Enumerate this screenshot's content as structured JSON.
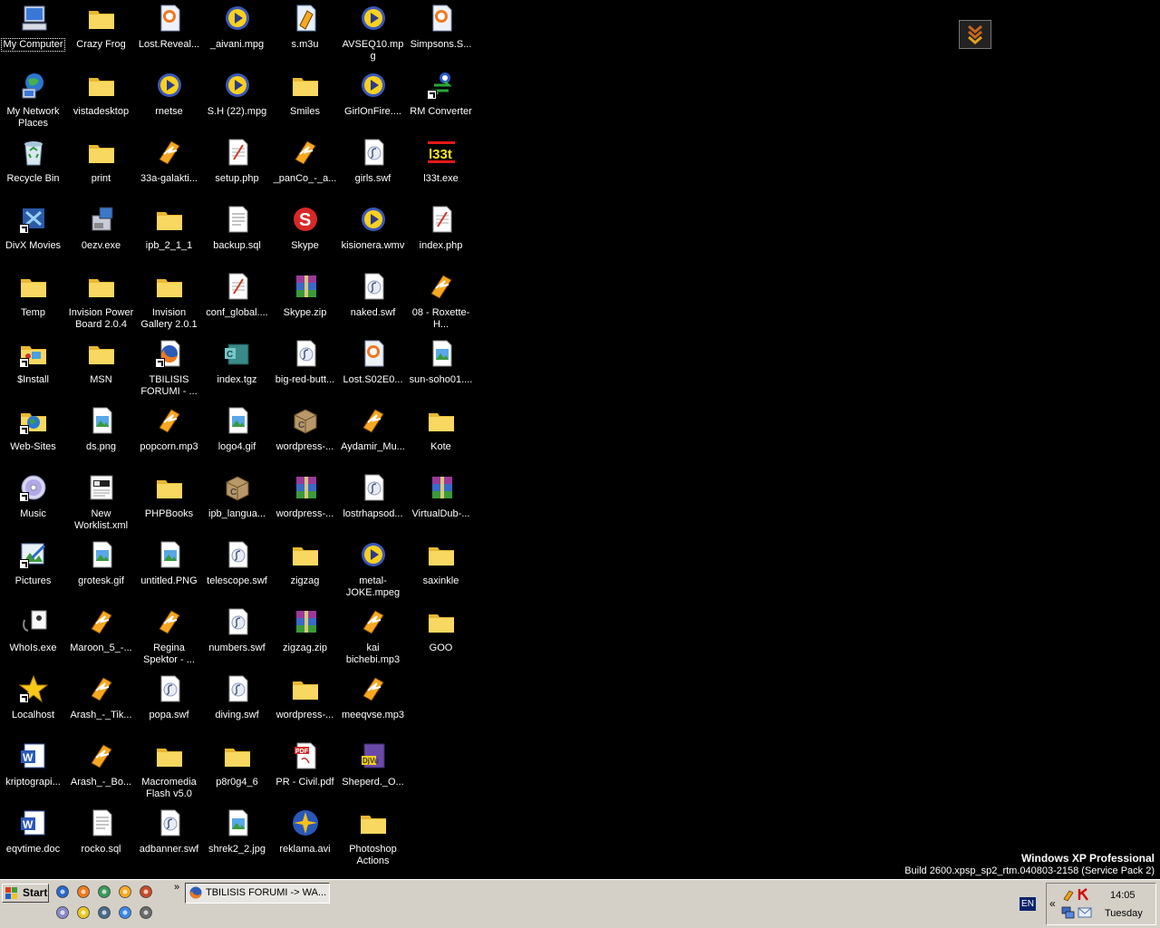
{
  "desktop": {
    "icons": [
      {
        "label": "My Computer",
        "type": "computer",
        "col": 0,
        "row": 0,
        "selected": true
      },
      {
        "label": "My Network Places",
        "type": "network",
        "col": 0,
        "row": 1
      },
      {
        "label": "Recycle Bin",
        "type": "recycle",
        "col": 0,
        "row": 2
      },
      {
        "label": "DivX Movies",
        "type": "divx",
        "col": 0,
        "row": 3,
        "shortcut": true
      },
      {
        "label": "Temp",
        "type": "folder",
        "col": 0,
        "row": 4
      },
      {
        "label": "$Install",
        "type": "folder-special",
        "col": 0,
        "row": 5,
        "shortcut": true
      },
      {
        "label": "Web-Sites",
        "type": "folder-globe",
        "col": 0,
        "row": 6,
        "shortcut": true
      },
      {
        "label": "Music",
        "type": "cd",
        "col": 0,
        "row": 7,
        "shortcut": true
      },
      {
        "label": "Pictures",
        "type": "pictures",
        "col": 0,
        "row": 8,
        "shortcut": true
      },
      {
        "label": "WhoIs.exe",
        "type": "exe",
        "col": 0,
        "row": 9
      },
      {
        "label": "Localhost",
        "type": "star",
        "col": 0,
        "row": 10,
        "shortcut": true
      },
      {
        "label": "kriptograpi...",
        "type": "word",
        "col": 0,
        "row": 11
      },
      {
        "label": "eqvtime.doc",
        "type": "word",
        "col": 0,
        "row": 12
      },
      {
        "label": "Crazy Frog",
        "type": "folder",
        "col": 1,
        "row": 0
      },
      {
        "label": "vistadesktop",
        "type": "folder",
        "col": 1,
        "row": 1
      },
      {
        "label": "print",
        "type": "folder",
        "col": 1,
        "row": 2
      },
      {
        "label": "0ezv.exe",
        "type": "setup",
        "col": 1,
        "row": 3
      },
      {
        "label": "Invision Power Board 2.0.4",
        "type": "folder",
        "col": 1,
        "row": 4
      },
      {
        "label": "MSN",
        "type": "folder",
        "col": 1,
        "row": 5
      },
      {
        "label": "ds.png",
        "type": "image",
        "col": 1,
        "row": 6
      },
      {
        "label": "New Worklist.xml",
        "type": "xml",
        "col": 1,
        "row": 7
      },
      {
        "label": "grotesk.gif",
        "type": "image",
        "col": 1,
        "row": 8
      },
      {
        "label": "Maroon_5_-...",
        "type": "winamp",
        "col": 1,
        "row": 9
      },
      {
        "label": "Arash_-_Tik...",
        "type": "winamp",
        "col": 1,
        "row": 10
      },
      {
        "label": "Arash_-_Bo...",
        "type": "winamp",
        "col": 1,
        "row": 11
      },
      {
        "label": "rocko.sql",
        "type": "text",
        "col": 1,
        "row": 12
      },
      {
        "label": "Lost.Reveal...",
        "type": "video-doc",
        "col": 2,
        "row": 0
      },
      {
        "label": "rnetse",
        "type": "media",
        "col": 2,
        "row": 1
      },
      {
        "label": "33a-galakti...",
        "type": "winamp",
        "col": 2,
        "row": 2
      },
      {
        "label": "ipb_2_1_1",
        "type": "folder",
        "col": 2,
        "row": 3
      },
      {
        "label": "Invision Gallery 2.0.1",
        "type": "folder",
        "col": 2,
        "row": 4
      },
      {
        "label": "TBILISIS FORUMI - ...",
        "type": "firefox",
        "col": 2,
        "row": 5,
        "shortcut": true
      },
      {
        "label": "popcorn.mp3",
        "type": "winamp",
        "col": 2,
        "row": 6
      },
      {
        "label": "PHPBooks",
        "type": "folder",
        "col": 2,
        "row": 7
      },
      {
        "label": "untitled.PNG",
        "type": "image",
        "col": 2,
        "row": 8
      },
      {
        "label": "Regina Spektor - ...",
        "type": "winamp",
        "col": 2,
        "row": 9
      },
      {
        "label": "popa.swf",
        "type": "swf",
        "col": 2,
        "row": 10
      },
      {
        "label": "Macromedia Flash v5.0",
        "type": "folder",
        "col": 2,
        "row": 11
      },
      {
        "label": "adbanner.swf",
        "type": "swf",
        "col": 2,
        "row": 12
      },
      {
        "label": "_aivani.mpg",
        "type": "media",
        "col": 3,
        "row": 0
      },
      {
        "label": "S.H (22).mpg",
        "type": "media",
        "col": 3,
        "row": 1
      },
      {
        "label": "setup.php",
        "type": "php",
        "col": 3,
        "row": 2
      },
      {
        "label": "backup.sql",
        "type": "text",
        "col": 3,
        "row": 3
      },
      {
        "label": "conf_global....",
        "type": "php",
        "col": 3,
        "row": 4
      },
      {
        "label": "index.tgz",
        "type": "tgz",
        "col": 3,
        "row": 5
      },
      {
        "label": "logo4.gif",
        "type": "image",
        "col": 3,
        "row": 6
      },
      {
        "label": "ipb_langua...",
        "type": "box",
        "col": 3,
        "row": 7
      },
      {
        "label": "telescope.swf",
        "type": "swf",
        "col": 3,
        "row": 8
      },
      {
        "label": "numbers.swf",
        "type": "swf",
        "col": 3,
        "row": 9
      },
      {
        "label": "diving.swf",
        "type": "swf",
        "col": 3,
        "row": 10
      },
      {
        "label": "p8r0g4_6",
        "type": "folder",
        "col": 3,
        "row": 11
      },
      {
        "label": "shrek2_2.jpg",
        "type": "image",
        "col": 3,
        "row": 12
      },
      {
        "label": "s.m3u",
        "type": "playlist",
        "col": 4,
        "row": 0
      },
      {
        "label": "Smiles",
        "type": "folder",
        "col": 4,
        "row": 1
      },
      {
        "label": "_panCo_-_a...",
        "type": "winamp",
        "col": 4,
        "row": 2
      },
      {
        "label": "Skype",
        "type": "skype",
        "col": 4,
        "row": 3
      },
      {
        "label": "Skype.zip",
        "type": "rar",
        "col": 4,
        "row": 4
      },
      {
        "label": "big-red-butt...",
        "type": "swf",
        "col": 4,
        "row": 5
      },
      {
        "label": "wordpress-...",
        "type": "box",
        "col": 4,
        "row": 6
      },
      {
        "label": "wordpress-...",
        "type": "rar",
        "col": 4,
        "row": 7
      },
      {
        "label": "zigzag",
        "type": "folder",
        "col": 4,
        "row": 8
      },
      {
        "label": "zigzag.zip",
        "type": "rar",
        "col": 4,
        "row": 9
      },
      {
        "label": "wordpress-...",
        "type": "folder",
        "col": 4,
        "row": 10
      },
      {
        "label": "PR - Civil.pdf",
        "type": "pdf",
        "col": 4,
        "row": 11
      },
      {
        "label": "reklama.avi",
        "type": "avi",
        "col": 4,
        "row": 12
      },
      {
        "label": "AVSEQ10.mpg",
        "type": "media",
        "col": 5,
        "row": 0
      },
      {
        "label": "GirlOnFire....",
        "type": "media",
        "col": 5,
        "row": 1
      },
      {
        "label": "girls.swf",
        "type": "swf",
        "col": 5,
        "row": 2
      },
      {
        "label": "kisionera.wmv",
        "type": "media",
        "col": 5,
        "row": 3
      },
      {
        "label": "naked.swf",
        "type": "swf",
        "col": 5,
        "row": 4
      },
      {
        "label": "Lost.S02E0...",
        "type": "video-doc",
        "col": 5,
        "row": 5
      },
      {
        "label": "Aydamir_Mu...",
        "type": "winamp",
        "col": 5,
        "row": 6
      },
      {
        "label": "lostrhapsod...",
        "type": "swf",
        "col": 5,
        "row": 7
      },
      {
        "label": "metal-JOKE.mpeg",
        "type": "media",
        "col": 5,
        "row": 8
      },
      {
        "label": "kai bichebi.mp3",
        "type": "winamp",
        "col": 5,
        "row": 9
      },
      {
        "label": "meeqvse.mp3",
        "type": "winamp",
        "col": 5,
        "row": 10
      },
      {
        "label": "Sheperd._O...",
        "type": "djvu",
        "col": 5,
        "row": 11
      },
      {
        "label": "Photoshop Actions",
        "type": "folder",
        "col": 5,
        "row": 12
      },
      {
        "label": "Simpsons.S...",
        "type": "video-doc",
        "col": 6,
        "row": 0
      },
      {
        "label": "RM Converter",
        "type": "converter",
        "col": 6,
        "row": 1,
        "shortcut": true
      },
      {
        "label": "l33t.exe",
        "type": "l33t",
        "col": 6,
        "row": 2
      },
      {
        "label": "index.php",
        "type": "php",
        "col": 6,
        "row": 3
      },
      {
        "label": "08 - Roxette-H...",
        "type": "winamp",
        "col": 6,
        "row": 4
      },
      {
        "label": "sun-soho01....",
        "type": "image",
        "col": 6,
        "row": 5
      },
      {
        "label": "Kote",
        "type": "folder",
        "col": 6,
        "row": 6
      },
      {
        "label": "VirtualDub-...",
        "type": "rar",
        "col": 6,
        "row": 7
      },
      {
        "label": "saxinkle",
        "type": "folder",
        "col": 6,
        "row": 8
      },
      {
        "label": "GOO",
        "type": "folder",
        "col": 6,
        "row": 9
      }
    ]
  },
  "watermark": {
    "line1": "Windows XP Professional",
    "line2": "Build 2600.xpsp_sp2_rtm.040803-2158 (Service Pack 2)"
  },
  "taskbar": {
    "start_label": "Start",
    "task_button_label": "TBILISIS FORUMI -> WA...",
    "quick_launch_chevron": "»",
    "language": "EN",
    "tray_chevron": "«",
    "clock_time": "14:05",
    "clock_day": "Tuesday",
    "quick_launch_icons": [
      "ie-icon",
      "firefox-icon",
      "network-tool-icon",
      "winamp-icon",
      "media-icon",
      "globe-icon",
      "messenger-icon",
      "desktop-icon",
      "ie-blue-icon",
      "clapper-icon"
    ]
  },
  "colors": {
    "desktop_bg": "#000000",
    "taskbar_bg": "#d4d0c8",
    "folder": "#f5d25c",
    "label_text": "#ffffff"
  }
}
